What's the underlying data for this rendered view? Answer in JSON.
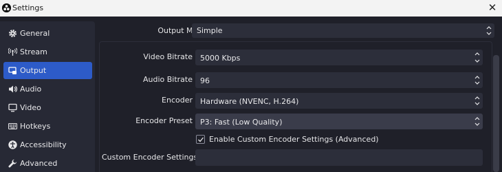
{
  "window": {
    "title": "Settings",
    "close_glyph": "✕",
    "logo_icon": "obs-logo-icon"
  },
  "sidebar": {
    "items": [
      {
        "label": "General",
        "icon": "gear-icon",
        "active": false
      },
      {
        "label": "Stream",
        "icon": "antenna-icon",
        "active": false
      },
      {
        "label": "Output",
        "icon": "output-icon",
        "active": true
      },
      {
        "label": "Audio",
        "icon": "speaker-icon",
        "active": false
      },
      {
        "label": "Video",
        "icon": "monitor-icon",
        "active": false
      },
      {
        "label": "Hotkeys",
        "icon": "keyboard-icon",
        "active": false
      },
      {
        "label": "Accessibility",
        "icon": "accessibility-icon",
        "active": false
      },
      {
        "label": "Advanced",
        "icon": "wrench-icon",
        "active": false
      }
    ]
  },
  "output": {
    "output_mode_label": "Output Mode",
    "output_mode_value": "Simple",
    "video_bitrate_label": "Video Bitrate",
    "video_bitrate_value": "5000 Kbps",
    "audio_bitrate_label": "Audio Bitrate",
    "audio_bitrate_value": "96",
    "encoder_label": "Encoder",
    "encoder_value": "Hardware (NVENC, H.264)",
    "encoder_preset_label": "Encoder Preset",
    "encoder_preset_value": "P3: Fast (Low Quality)",
    "custom_checkbox_label": "Enable Custom Encoder Settings (Advanced)",
    "custom_checkbox_checked": true,
    "custom_settings_label": "Custom Encoder Settings",
    "custom_settings_value": ""
  },
  "colors": {
    "accent": "#2d5bc8",
    "background": "#1f2029",
    "sidebar": "#272935",
    "field": "#2c2e3a",
    "titlebar": "#f3f3f3"
  }
}
